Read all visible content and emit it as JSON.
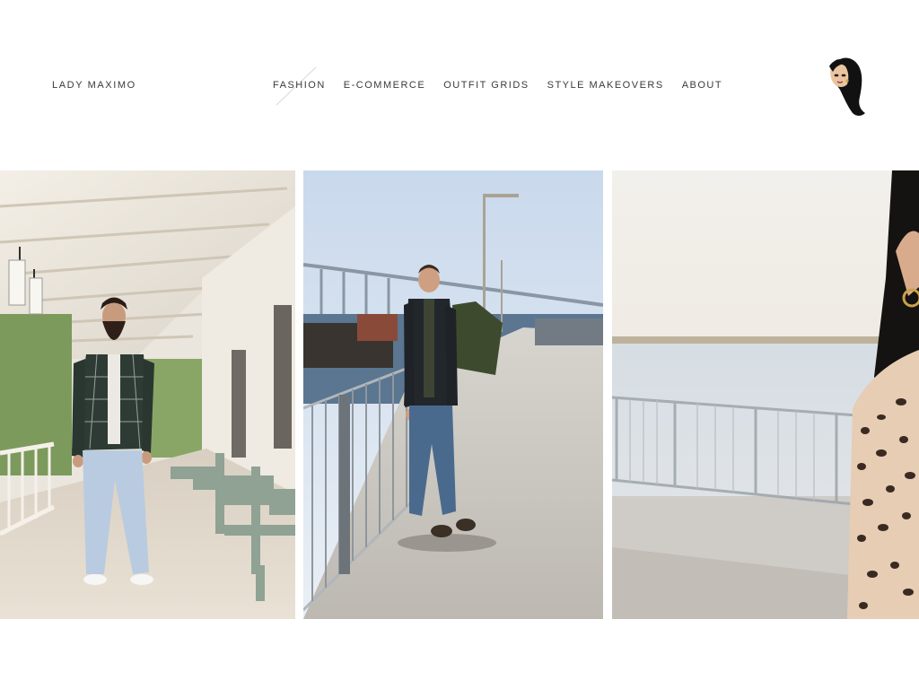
{
  "site": {
    "title": "LADY MAXIMO",
    "logo_icon": "woman-portrait-logo-icon"
  },
  "nav": {
    "items": [
      {
        "label": "FASHION"
      },
      {
        "label": "E-COMMERCE"
      },
      {
        "label": "OUTFIT GRIDS"
      },
      {
        "label": "STYLE MAKEOVERS"
      },
      {
        "label": "ABOUT"
      }
    ]
  },
  "gallery": {
    "photos": [
      {
        "subject": "bearded-man-porch-photo"
      },
      {
        "subject": "man-pier-backpack-photo"
      },
      {
        "subject": "woman-leopard-jacket-photo"
      }
    ]
  }
}
